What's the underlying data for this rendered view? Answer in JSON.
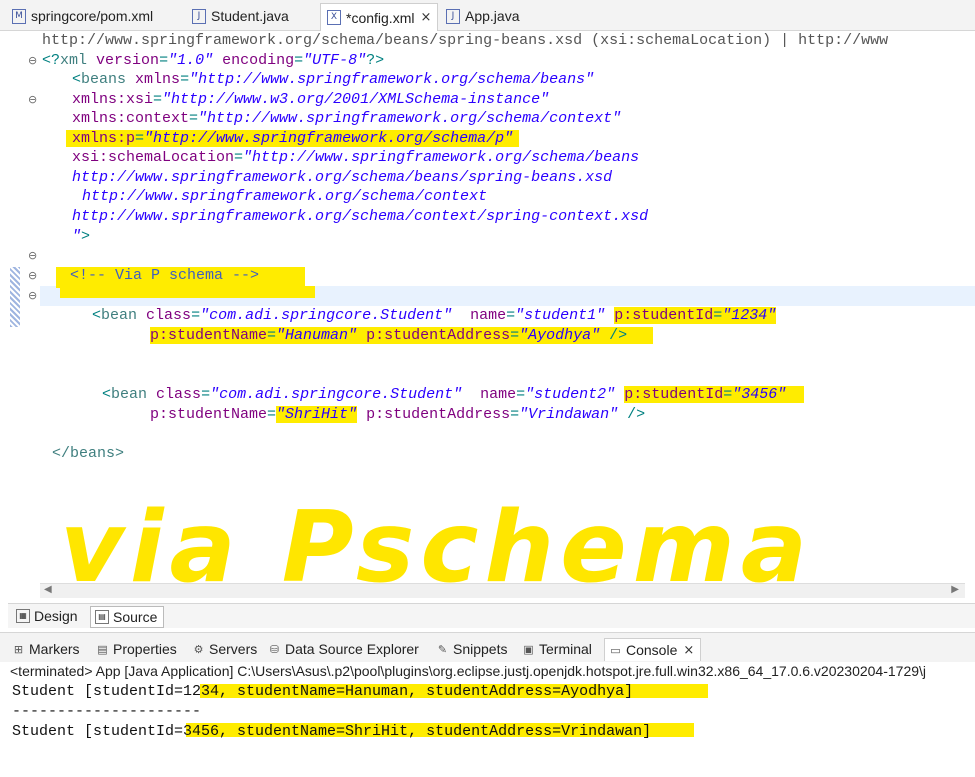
{
  "tabs": [
    {
      "label": "springcore/pom.xml",
      "icon": "maven-file-icon",
      "active": false
    },
    {
      "label": "Student.java",
      "icon": "java-file-icon",
      "active": false
    },
    {
      "label": "*config.xml",
      "icon": "xml-file-icon",
      "active": true,
      "close": "×"
    },
    {
      "label": "App.java",
      "icon": "java-file-icon",
      "active": false
    }
  ],
  "editor": {
    "breadcrumb": "http://www.springframework.org/schema/beans/spring-beans.xsd (xsi:schemaLocation) | http://www",
    "xml_decl": {
      "open": "<?",
      "tag": "xml",
      "version_attr": "version",
      "version_val": "\"1.0\"",
      "enc_attr": "encoding",
      "enc_val": "\"UTF-8\"",
      "close": "?>"
    },
    "beans_open": {
      "lt": "<",
      "tag": "beans",
      "attr": "xmlns",
      "val": "\"http://www.springframework.org/schema/beans\""
    },
    "ns_xsi": {
      "attr": "xmlns:xsi",
      "val": "\"http://www.w3.org/2001/XMLSchema-instance\""
    },
    "ns_context": {
      "attr": "xmlns:context",
      "val": "\"http://www.springframework.org/schema/context\""
    },
    "ns_p": {
      "attr": "xmlns:p",
      "val": "\"http://www.springframework.org/schema/p\""
    },
    "schema_loc": {
      "attr": "xsi:schemaLocation",
      "val": "\"http://www.springframework.org/schema/beans"
    },
    "schema_l2": "http://www.springframework.org/schema/beans/spring-beans.xsd",
    "schema_l3": "http://www.springframework.org/schema/context",
    "schema_l4": "http://www.springframework.org/schema/context/spring-context.xsd",
    "schema_l5_val": "\"",
    "schema_l5_close": ">",
    "comment": "<!-- Via P schema -->",
    "bean1": {
      "lt": "<",
      "tag": "bean",
      "class_attr": "class",
      "class_val": "\"com.adi.springcore.Student\"",
      "name_attr": "name",
      "name_val": "\"student1\"",
      "id_attr": "p:studentId",
      "id_val": "\"1234\"",
      "sname_attr": "p:studentName",
      "sname_val": "\"Hanuman\"",
      "addr_attr": "p:studentAddress",
      "addr_val": "\"Ayodhya\"",
      "end": "/>"
    },
    "bean2": {
      "lt": "<",
      "tag": "bean",
      "class_attr": "class",
      "class_val": "\"com.adi.springcore.Student\"",
      "name_attr": "name",
      "name_val": "\"student2\"",
      "id_attr": "p:studentId",
      "id_val": "\"3456\"",
      "sname_attr": "p:studentName",
      "sname_val": "\"ShriHit\"",
      "addr_attr": "p:studentAddress",
      "addr_val": "\"Vrindawan\"",
      "end": "/>"
    },
    "beans_close": "</beans>",
    "handwritten_note": "via Pschema"
  },
  "design_tabs": [
    {
      "label": "Design",
      "icon": "design-tab-icon",
      "active": false
    },
    {
      "label": "Source",
      "icon": "source-tab-icon",
      "active": true
    }
  ],
  "view_tabs": [
    {
      "label": "Markers",
      "icon": "markers-icon",
      "glyph": "⊞",
      "active": false
    },
    {
      "label": "Properties",
      "icon": "properties-icon",
      "glyph": "▤",
      "active": false
    },
    {
      "label": "Servers",
      "icon": "servers-icon",
      "glyph": "⚙",
      "active": false
    },
    {
      "label": "Data Source Explorer",
      "icon": "data-source-icon",
      "glyph": "⛁",
      "active": false
    },
    {
      "label": "Snippets",
      "icon": "snippets-icon",
      "glyph": "✎",
      "active": false
    },
    {
      "label": "Terminal",
      "icon": "terminal-icon",
      "glyph": "▣",
      "active": false
    },
    {
      "label": "Console",
      "icon": "console-icon",
      "glyph": "▭",
      "active": true,
      "close": "×"
    }
  ],
  "console": {
    "terminated": "<terminated> App [Java Application] C:\\Users\\Asus\\.p2\\pool\\plugins\\org.eclipse.justj.openjdk.hotspot.jre.full.win32.x86_64_17.0.6.v20230204-1729\\j",
    "lines": [
      "Student [studentId=1234, studentName=Hanuman, studentAddress=Ayodhya]",
      "---------------------",
      "Student [studentId=3456, studentName=ShriHit, studentAddress=Vrindawan]"
    ]
  },
  "colors": {
    "highlight": "#ffec00",
    "tag": "#3f7f7f",
    "attr": "#7f007f",
    "value": "#2a00ff",
    "comment": "#3f5fbf"
  }
}
